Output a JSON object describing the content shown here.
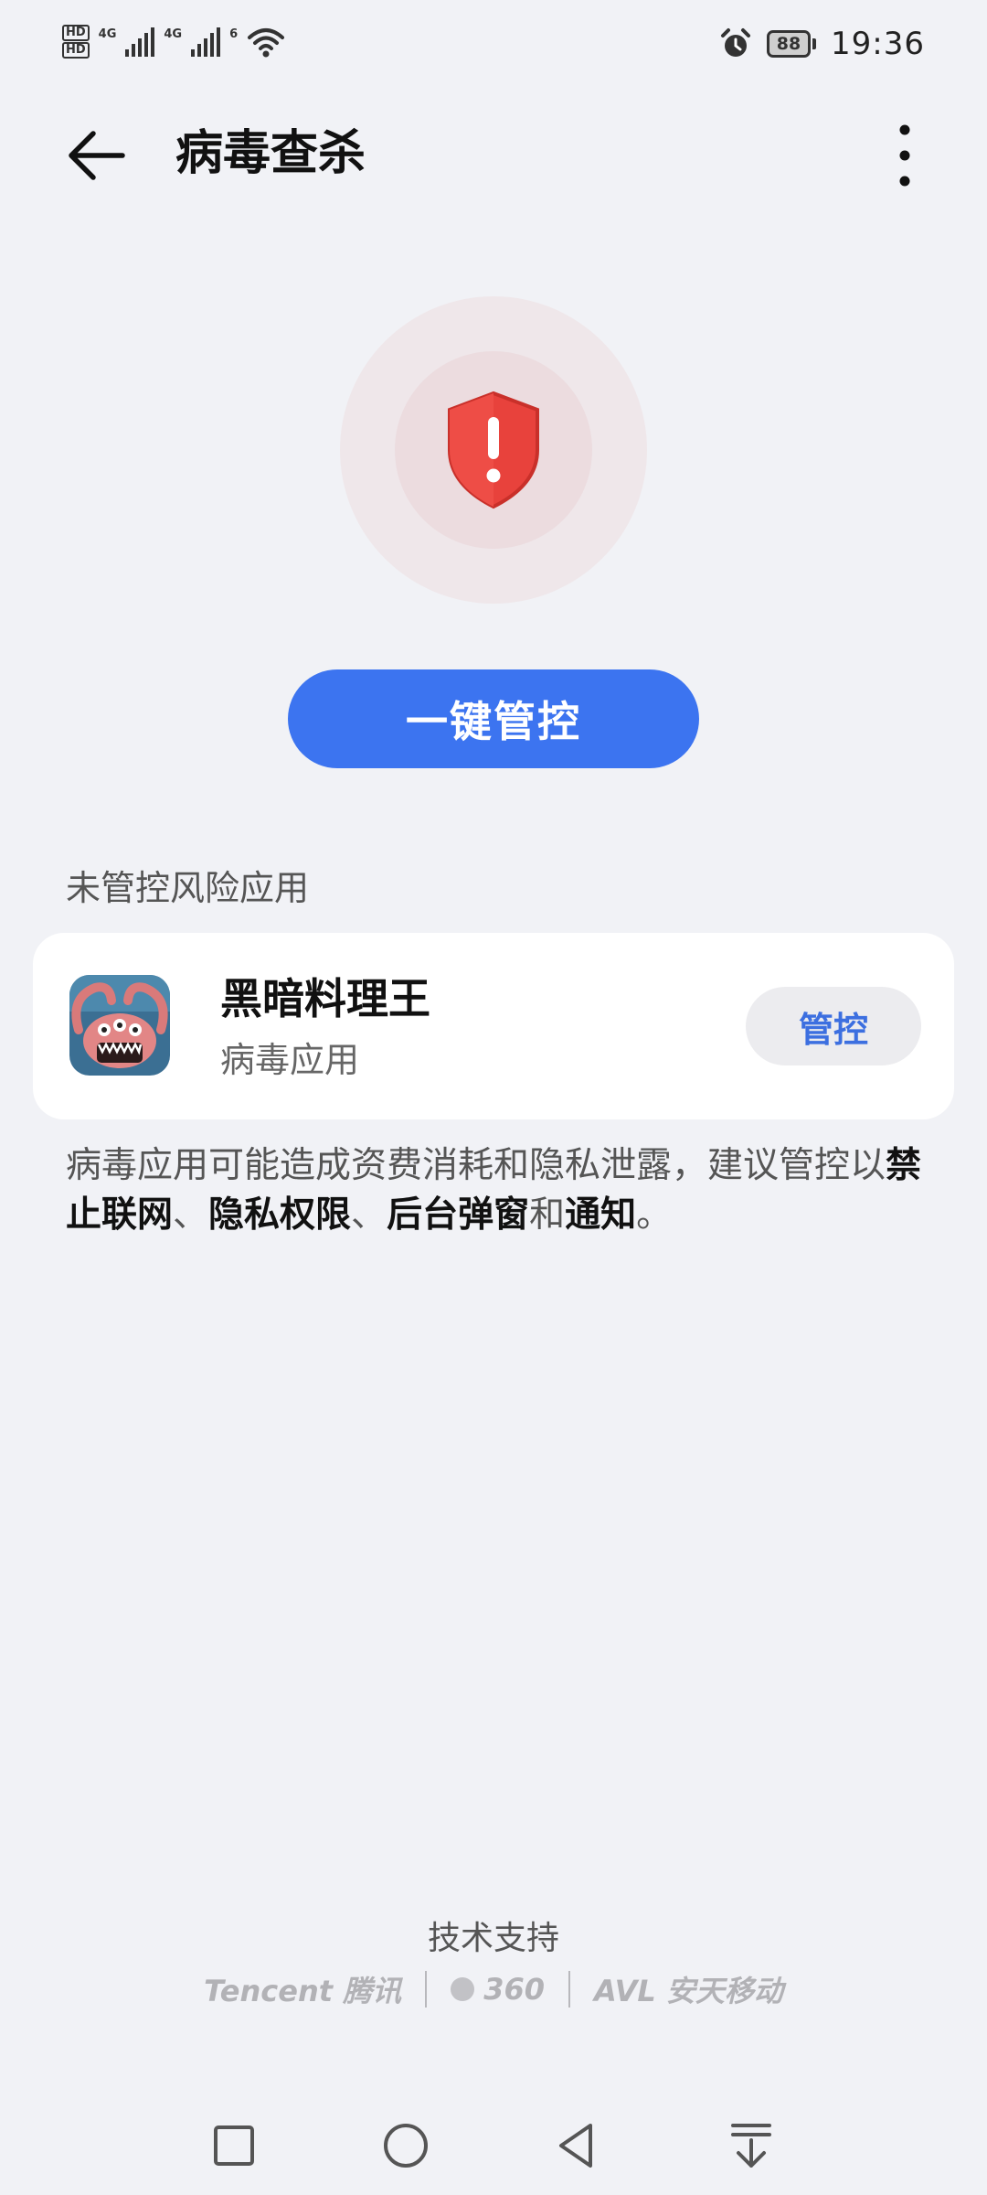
{
  "status_bar": {
    "hd": "HD",
    "network_1": "4G",
    "network_2": "4G",
    "wifi": "6",
    "battery": "88",
    "time": "19:36",
    "icons": [
      "signal-icon",
      "wifi-icon",
      "alarm-icon",
      "battery-icon"
    ]
  },
  "header": {
    "title": "病毒查杀",
    "back_icon": "back-arrow-icon",
    "more_icon": "more-vertical-icon"
  },
  "status_icon": "shield-warning-icon",
  "primary_button": {
    "label": "一键管控"
  },
  "section": {
    "label": "未管控风险应用"
  },
  "apps": [
    {
      "name": "黑暗料理王",
      "type": "病毒应用",
      "action": "管控"
    }
  ],
  "description": {
    "prefix": "病毒应用可能造成资费消耗和隐私泄露，建议管控以",
    "item1": "禁止联网",
    "sep1": "、",
    "item2": "隐私权限",
    "sep2": "、",
    "item3": "后台弹窗",
    "conj": "和",
    "item4": "通知",
    "end": "。"
  },
  "footer": {
    "support_label": "技术支持",
    "partners": [
      "Tencent 腾讯",
      "360",
      "AVL 安天移动"
    ]
  },
  "nav": [
    "square-icon",
    "circle-home-icon",
    "triangle-back-icon",
    "notification-pull-icon"
  ],
  "colors": {
    "accent": "#3c74f0",
    "danger": "#e8423c",
    "background": "#f1f2f6"
  }
}
